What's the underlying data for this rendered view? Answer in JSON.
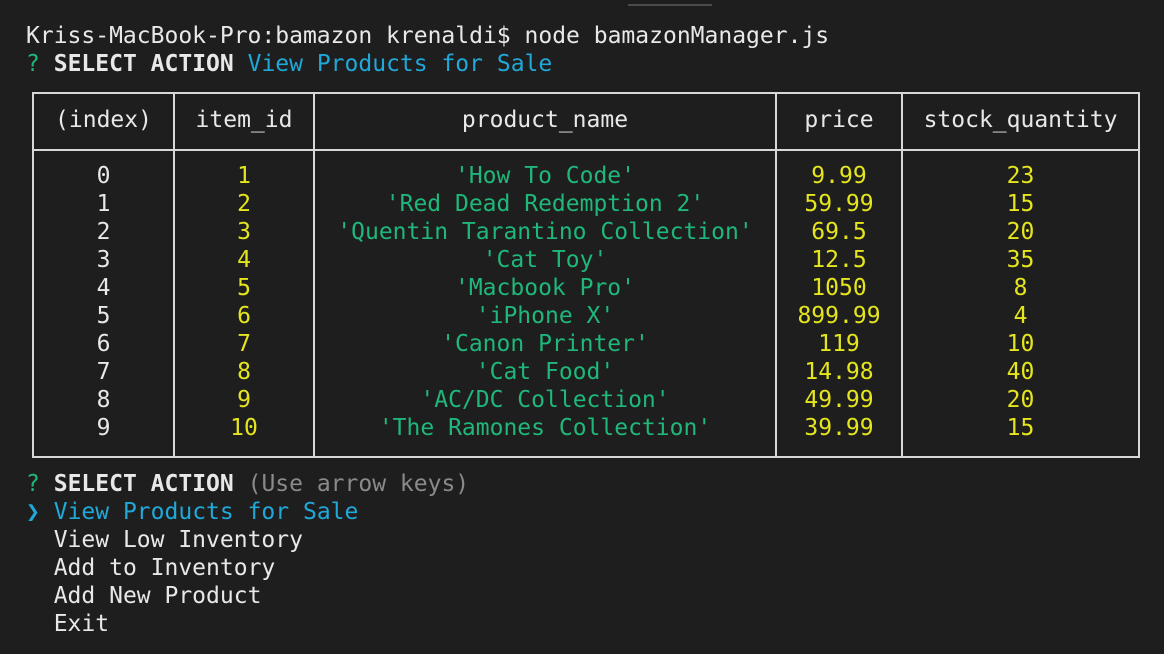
{
  "terminal": {
    "prompt_line": "Kriss-MacBook-Pro:bamazon krenaldi$ node bamazonManager.js",
    "first_question": {
      "mark": "?",
      "label": "SELECT ACTION",
      "answer": "View Products for Sale"
    },
    "table": {
      "headers": [
        "(index)",
        "item_id",
        "product_name",
        "price",
        "stock_quantity"
      ],
      "rows": [
        {
          "index": "0",
          "item_id": "1",
          "product_name": "'How To Code'",
          "price": "9.99",
          "stock_quantity": "23"
        },
        {
          "index": "1",
          "item_id": "2",
          "product_name": "'Red Dead Redemption 2'",
          "price": "59.99",
          "stock_quantity": "15"
        },
        {
          "index": "2",
          "item_id": "3",
          "product_name": "'Quentin Tarantino Collection'",
          "price": "69.5",
          "stock_quantity": "20"
        },
        {
          "index": "3",
          "item_id": "4",
          "product_name": "'Cat Toy'",
          "price": "12.5",
          "stock_quantity": "35"
        },
        {
          "index": "4",
          "item_id": "5",
          "product_name": "'Macbook Pro'",
          "price": "1050",
          "stock_quantity": "8"
        },
        {
          "index": "5",
          "item_id": "6",
          "product_name": "'iPhone X'",
          "price": "899.99",
          "stock_quantity": "4"
        },
        {
          "index": "6",
          "item_id": "7",
          "product_name": "'Canon Printer'",
          "price": "119",
          "stock_quantity": "10"
        },
        {
          "index": "7",
          "item_id": "8",
          "product_name": "'Cat Food'",
          "price": "14.98",
          "stock_quantity": "40"
        },
        {
          "index": "8",
          "item_id": "9",
          "product_name": "'AC/DC Collection'",
          "price": "49.99",
          "stock_quantity": "20"
        },
        {
          "index": "9",
          "item_id": "10",
          "product_name": "'The Ramones Collection'",
          "price": "39.99",
          "stock_quantity": "15"
        }
      ]
    },
    "second_question": {
      "mark": "?",
      "label": "SELECT ACTION",
      "hint": "(Use arrow keys)"
    },
    "menu": {
      "pointer": "❯",
      "items": [
        "View Products for Sale",
        "View Low Inventory",
        "Add to Inventory",
        "Add New Product",
        "Exit"
      ]
    },
    "colors": {
      "background": "#1e1e1e",
      "question_mark": "#1fb77a",
      "answer_cyan": "#20a8d8",
      "number_yellow": "#e5e51e",
      "string_green": "#1fb77a"
    }
  }
}
